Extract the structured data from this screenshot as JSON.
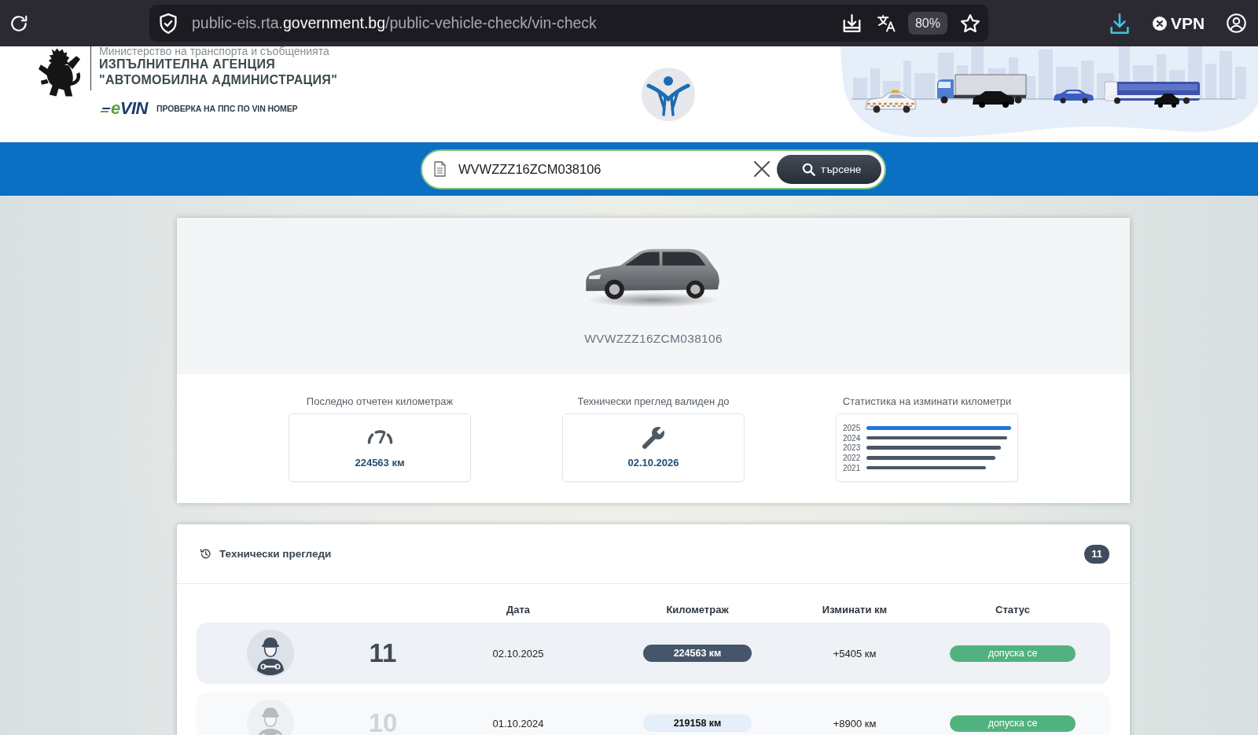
{
  "browser": {
    "url": {
      "prefix": "public-eis.rta.",
      "domain": "government.bg",
      "path": "/public-vehicle-check/vin-check"
    },
    "zoom": "80%",
    "vpn": "VPN"
  },
  "header": {
    "ministry": "Министерство на транспорта и съобщенията",
    "agency": [
      "ИЗПЪЛНИТЕЛНА АГЕНЦИЯ",
      "\"АВТОМОБИЛНА АДМИНИСТРАЦИЯ\""
    ],
    "evin_logo": "eVIN",
    "tagline": "ПРОВЕРКА НА ППС ПО VIN НОМЕР"
  },
  "search": {
    "value": "WVWZZZ16ZCM038106",
    "button": "търсене"
  },
  "vehicle": {
    "vin": "WVWZZZ16ZCM038106",
    "stats": [
      {
        "kind": "mileage",
        "label": "Последно отчетен километраж",
        "value": "224563 км"
      },
      {
        "kind": "inspection",
        "label": "Технически преглед валиден до",
        "value": "02.10.2026"
      },
      {
        "kind": "chart",
        "label": "Статистика на изминати километри",
        "bars": [
          {
            "year": "2025",
            "color": "#1f78e0"
          },
          {
            "year": "2024",
            "color": "#4a5866"
          },
          {
            "year": "2023",
            "color": "#4a5866"
          },
          {
            "year": "2022",
            "color": "#4a5866"
          },
          {
            "year": "2021",
            "color": "#4a5866"
          }
        ]
      }
    ]
  },
  "inspections": {
    "title": "Технически прегледи",
    "count": "11",
    "columns": [
      "Дата",
      "Километраж",
      "Изминати км",
      "Статус"
    ],
    "rows": [
      {
        "number": "11",
        "date": "02.10.2025",
        "mileage": "224563 км",
        "distance": "+5405 км",
        "status": "допуска се",
        "latest": true
      },
      {
        "number": "10",
        "date": "01.10.2024",
        "mileage": "219158 км",
        "distance": "+8900 км",
        "status": "допуска се",
        "latest": false
      }
    ]
  }
}
